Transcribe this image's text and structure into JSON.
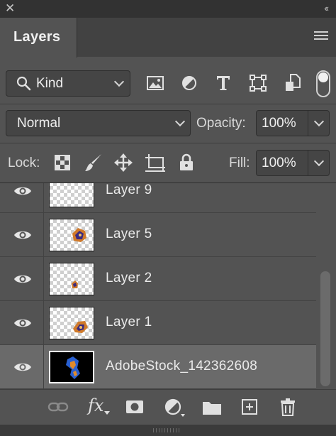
{
  "panel": {
    "tab_label": "Layers"
  },
  "filter": {
    "kind_label": "Kind"
  },
  "blend": {
    "mode": "Normal",
    "opacity_label": "Opacity:",
    "opacity_value": "100%"
  },
  "lock": {
    "label": "Lock:",
    "fill_label": "Fill:",
    "fill_value": "100%"
  },
  "layers": [
    {
      "name": "Layer 9",
      "visible": true,
      "selected": false
    },
    {
      "name": "Layer 5",
      "visible": true,
      "selected": false
    },
    {
      "name": "Layer 2",
      "visible": true,
      "selected": false
    },
    {
      "name": "Layer 1",
      "visible": true,
      "selected": false
    },
    {
      "name": "AdobeStock_142362608",
      "visible": true,
      "selected": true
    }
  ],
  "footer": {
    "fx_label": "fx"
  },
  "colors": {
    "panel_bg": "#535353",
    "selected_row": "#6a6a6a",
    "title_bar": "#323232"
  },
  "icons": {
    "filter_icons": [
      "image-filter-icon",
      "adjustment-filter-icon",
      "type-filter-icon",
      "shape-filter-icon",
      "smart-object-filter-icon",
      "filter-toggle-icon"
    ],
    "lock_icons": [
      "lock-transparent-pixels-icon",
      "lock-image-pixels-icon",
      "lock-position-icon",
      "lock-artboard-icon",
      "lock-all-icon"
    ],
    "footer_icons": [
      "link-layers-icon",
      "fx-icon",
      "add-mask-icon",
      "adjustment-layer-icon",
      "new-group-icon",
      "new-layer-icon",
      "delete-layer-icon"
    ]
  }
}
